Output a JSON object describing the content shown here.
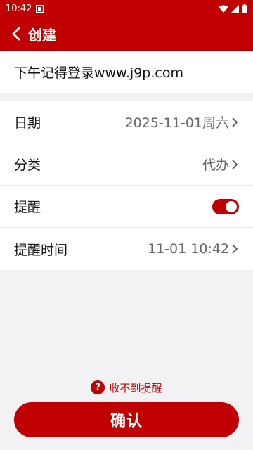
{
  "status": {
    "time": "10:42"
  },
  "header": {
    "title": "创建"
  },
  "note": {
    "text": "下午记得登录www.j9p.com"
  },
  "rows": {
    "date": {
      "label": "日期",
      "value": "2025-11-01周六"
    },
    "category": {
      "label": "分类",
      "value": "代办"
    },
    "reminder": {
      "label": "提醒",
      "enabled": true
    },
    "reminder_time": {
      "label": "提醒时间",
      "value": "11-01 10:42"
    }
  },
  "help": {
    "text": "收不到提醒"
  },
  "footer": {
    "confirm_label": "确认"
  },
  "colors": {
    "accent": "#c00000",
    "background": "#f2f2f4"
  },
  "icons": [
    "back-icon",
    "chevron-right-icon",
    "question-icon",
    "wifi-icon",
    "signal-icon",
    "battery-icon"
  ]
}
